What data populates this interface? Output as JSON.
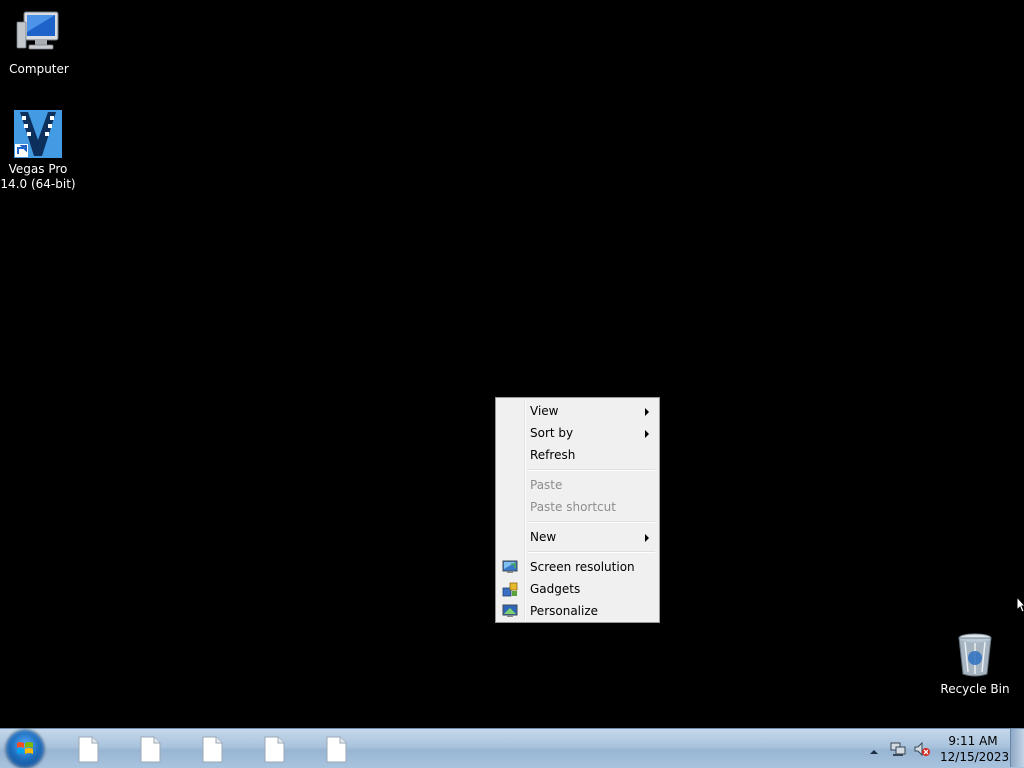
{
  "desktop": {
    "icons": [
      {
        "label": "Computer",
        "icon": "computer-icon"
      },
      {
        "label": "Vegas Pro 14.0 (64-bit)",
        "icon": "vegas-pro-icon"
      },
      {
        "label": "Recycle Bin",
        "icon": "recycle-bin-icon"
      }
    ]
  },
  "context_menu": {
    "items": [
      {
        "label": "View",
        "has_submenu": true,
        "enabled": true
      },
      {
        "label": "Sort by",
        "has_submenu": true,
        "enabled": true
      },
      {
        "label": "Refresh",
        "has_submenu": false,
        "enabled": true
      },
      {
        "label": "Paste",
        "has_submenu": false,
        "enabled": false
      },
      {
        "label": "Paste shortcut",
        "has_submenu": false,
        "enabled": false
      },
      {
        "label": "New",
        "has_submenu": true,
        "enabled": true
      },
      {
        "label": "Screen resolution",
        "icon": "screen-resolution-icon",
        "enabled": true
      },
      {
        "label": "Gadgets",
        "icon": "gadgets-icon",
        "enabled": true
      },
      {
        "label": "Personalize",
        "icon": "personalize-icon",
        "enabled": true
      }
    ]
  },
  "taskbar": {
    "start_icon": "windows-logo-icon",
    "pinned": [
      "document-icon",
      "document-icon",
      "document-icon",
      "document-icon",
      "document-icon"
    ],
    "tray": [
      "show-hidden-icons-arrow",
      "network-icon",
      "volume-muted-icon"
    ],
    "clock": {
      "time": "9:11 AM",
      "date": "12/15/2023"
    }
  },
  "colors": {
    "desktop_bg": "#000000",
    "menu_bg": "#f0f0f0",
    "menu_disabled_text": "#8d8d8d",
    "taskbar": "#a9c3dd"
  }
}
